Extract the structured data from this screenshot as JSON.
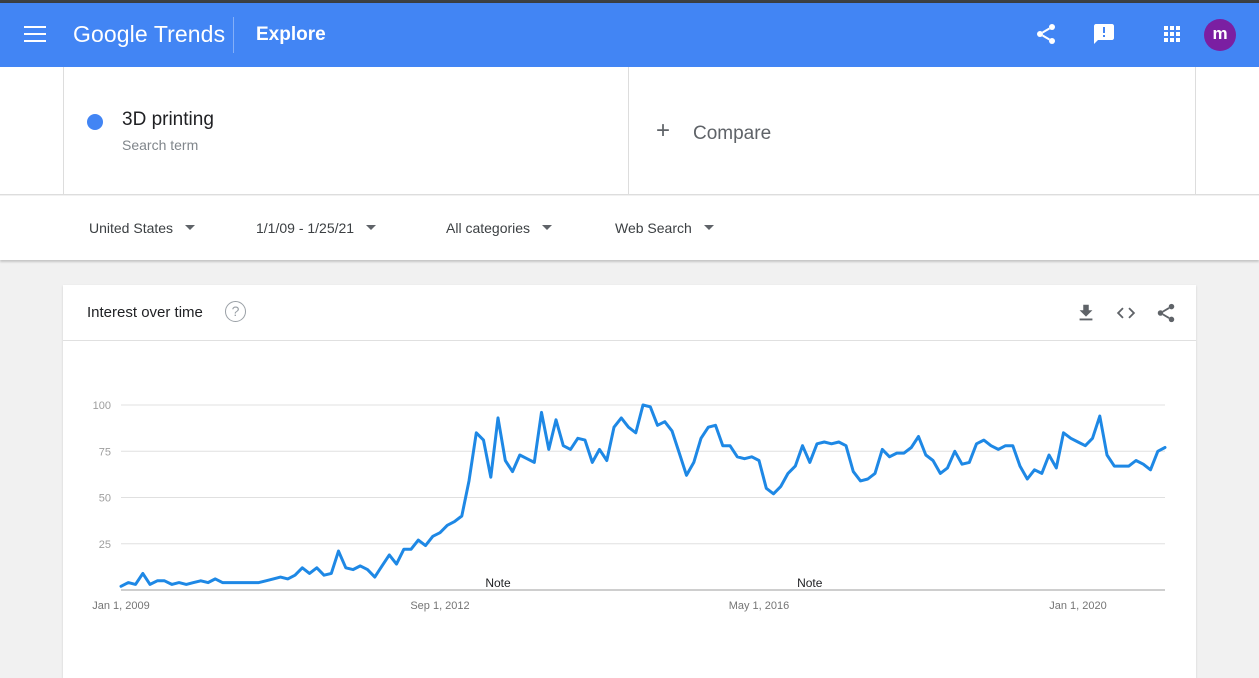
{
  "app": {
    "logo_text": "Google Trends",
    "section": "Explore",
    "avatar_initial": "m"
  },
  "search": {
    "term": "3D printing",
    "term_type": "Search term",
    "term_color": "#4285f4",
    "compare_label": "Compare"
  },
  "filters": {
    "region": "United States",
    "date_range": "1/1/09 - 1/25/21",
    "category": "All categories",
    "property": "Web Search"
  },
  "card": {
    "title": "Interest over time",
    "help_glyph": "?"
  },
  "colors": {
    "brand_blue": "#4285f4",
    "series_blue": "#1e88e5",
    "avatar_purple": "#7b1fa2"
  },
  "chart_data": {
    "type": "line",
    "title": "Interest over time",
    "xlabel": "",
    "ylabel": "",
    "ylim": [
      0,
      100
    ],
    "y_ticks": [
      25,
      50,
      75,
      100
    ],
    "x_tick_labels": [
      "Jan 1, 2009",
      "Sep 1, 2012",
      "May 1, 2016",
      "Jan 1, 2020"
    ],
    "x_range": [
      "2009-01",
      "2021-01"
    ],
    "grid": true,
    "annotations": [
      {
        "label": "Note",
        "date": "2013-05"
      },
      {
        "label": "Note",
        "date": "2016-12"
      }
    ],
    "series": [
      {
        "name": "3D printing",
        "x": [
          "2009-01",
          "2009-02",
          "2009-03",
          "2009-04",
          "2009-05",
          "2009-06",
          "2009-07",
          "2009-08",
          "2009-09",
          "2009-10",
          "2009-11",
          "2009-12",
          "2010-01",
          "2010-02",
          "2010-03",
          "2010-04",
          "2010-05",
          "2010-06",
          "2010-07",
          "2010-08",
          "2010-09",
          "2010-10",
          "2010-11",
          "2010-12",
          "2011-01",
          "2011-02",
          "2011-03",
          "2011-04",
          "2011-05",
          "2011-06",
          "2011-07",
          "2011-08",
          "2011-09",
          "2011-10",
          "2011-11",
          "2011-12",
          "2012-01",
          "2012-02",
          "2012-03",
          "2012-04",
          "2012-05",
          "2012-06",
          "2012-07",
          "2012-08",
          "2012-09",
          "2012-10",
          "2012-11",
          "2012-12",
          "2013-01",
          "2013-02",
          "2013-03",
          "2013-04",
          "2013-05",
          "2013-06",
          "2013-07",
          "2013-08",
          "2013-09",
          "2013-10",
          "2013-11",
          "2013-12",
          "2014-01",
          "2014-02",
          "2014-03",
          "2014-04",
          "2014-05",
          "2014-06",
          "2014-07",
          "2014-08",
          "2014-09",
          "2014-10",
          "2014-11",
          "2014-12",
          "2015-01",
          "2015-02",
          "2015-03",
          "2015-04",
          "2015-05",
          "2015-06",
          "2015-07",
          "2015-08",
          "2015-09",
          "2015-10",
          "2015-11",
          "2015-12",
          "2016-01",
          "2016-02",
          "2016-03",
          "2016-04",
          "2016-05",
          "2016-06",
          "2016-07",
          "2016-08",
          "2016-09",
          "2016-10",
          "2016-11",
          "2016-12",
          "2017-01",
          "2017-02",
          "2017-03",
          "2017-04",
          "2017-05",
          "2017-06",
          "2017-07",
          "2017-08",
          "2017-09",
          "2017-10",
          "2017-11",
          "2017-12",
          "2018-01",
          "2018-02",
          "2018-03",
          "2018-04",
          "2018-05",
          "2018-06",
          "2018-07",
          "2018-08",
          "2018-09",
          "2018-10",
          "2018-11",
          "2018-12",
          "2019-01",
          "2019-02",
          "2019-03",
          "2019-04",
          "2019-05",
          "2019-06",
          "2019-07",
          "2019-08",
          "2019-09",
          "2019-10",
          "2019-11",
          "2019-12",
          "2020-01",
          "2020-02",
          "2020-03",
          "2020-04",
          "2020-05",
          "2020-06",
          "2020-07",
          "2020-08",
          "2020-09",
          "2020-10",
          "2020-11",
          "2020-12",
          "2021-01"
        ],
        "y": [
          2,
          4,
          3,
          9,
          3,
          5,
          5,
          3,
          4,
          3,
          4,
          5,
          4,
          6,
          4,
          4,
          4,
          4,
          4,
          4,
          5,
          6,
          7,
          6,
          8,
          12,
          9,
          12,
          8,
          9,
          21,
          12,
          11,
          13,
          11,
          7,
          13,
          19,
          14,
          22,
          22,
          27,
          24,
          29,
          31,
          35,
          37,
          40,
          59,
          85,
          81,
          61,
          93,
          70,
          64,
          73,
          71,
          69,
          96,
          76,
          92,
          78,
          76,
          82,
          81,
          69,
          76,
          70,
          88,
          93,
          88,
          85,
          100,
          99,
          89,
          91,
          86,
          74,
          62,
          69,
          82,
          88,
          89,
          78,
          78,
          72,
          71,
          72,
          70,
          55,
          52,
          56,
          63,
          67,
          78,
          69,
          79,
          80,
          79,
          80,
          78,
          64,
          59,
          60,
          63,
          76,
          72,
          74,
          74,
          77,
          83,
          73,
          70,
          63,
          66,
          75,
          68,
          69,
          79,
          81,
          78,
          76,
          78,
          78,
          67,
          60,
          65,
          63,
          73,
          66,
          85,
          82,
          80,
          78,
          82,
          94,
          73,
          67,
          67,
          67,
          70,
          68,
          65,
          75,
          77
        ]
      }
    ]
  }
}
